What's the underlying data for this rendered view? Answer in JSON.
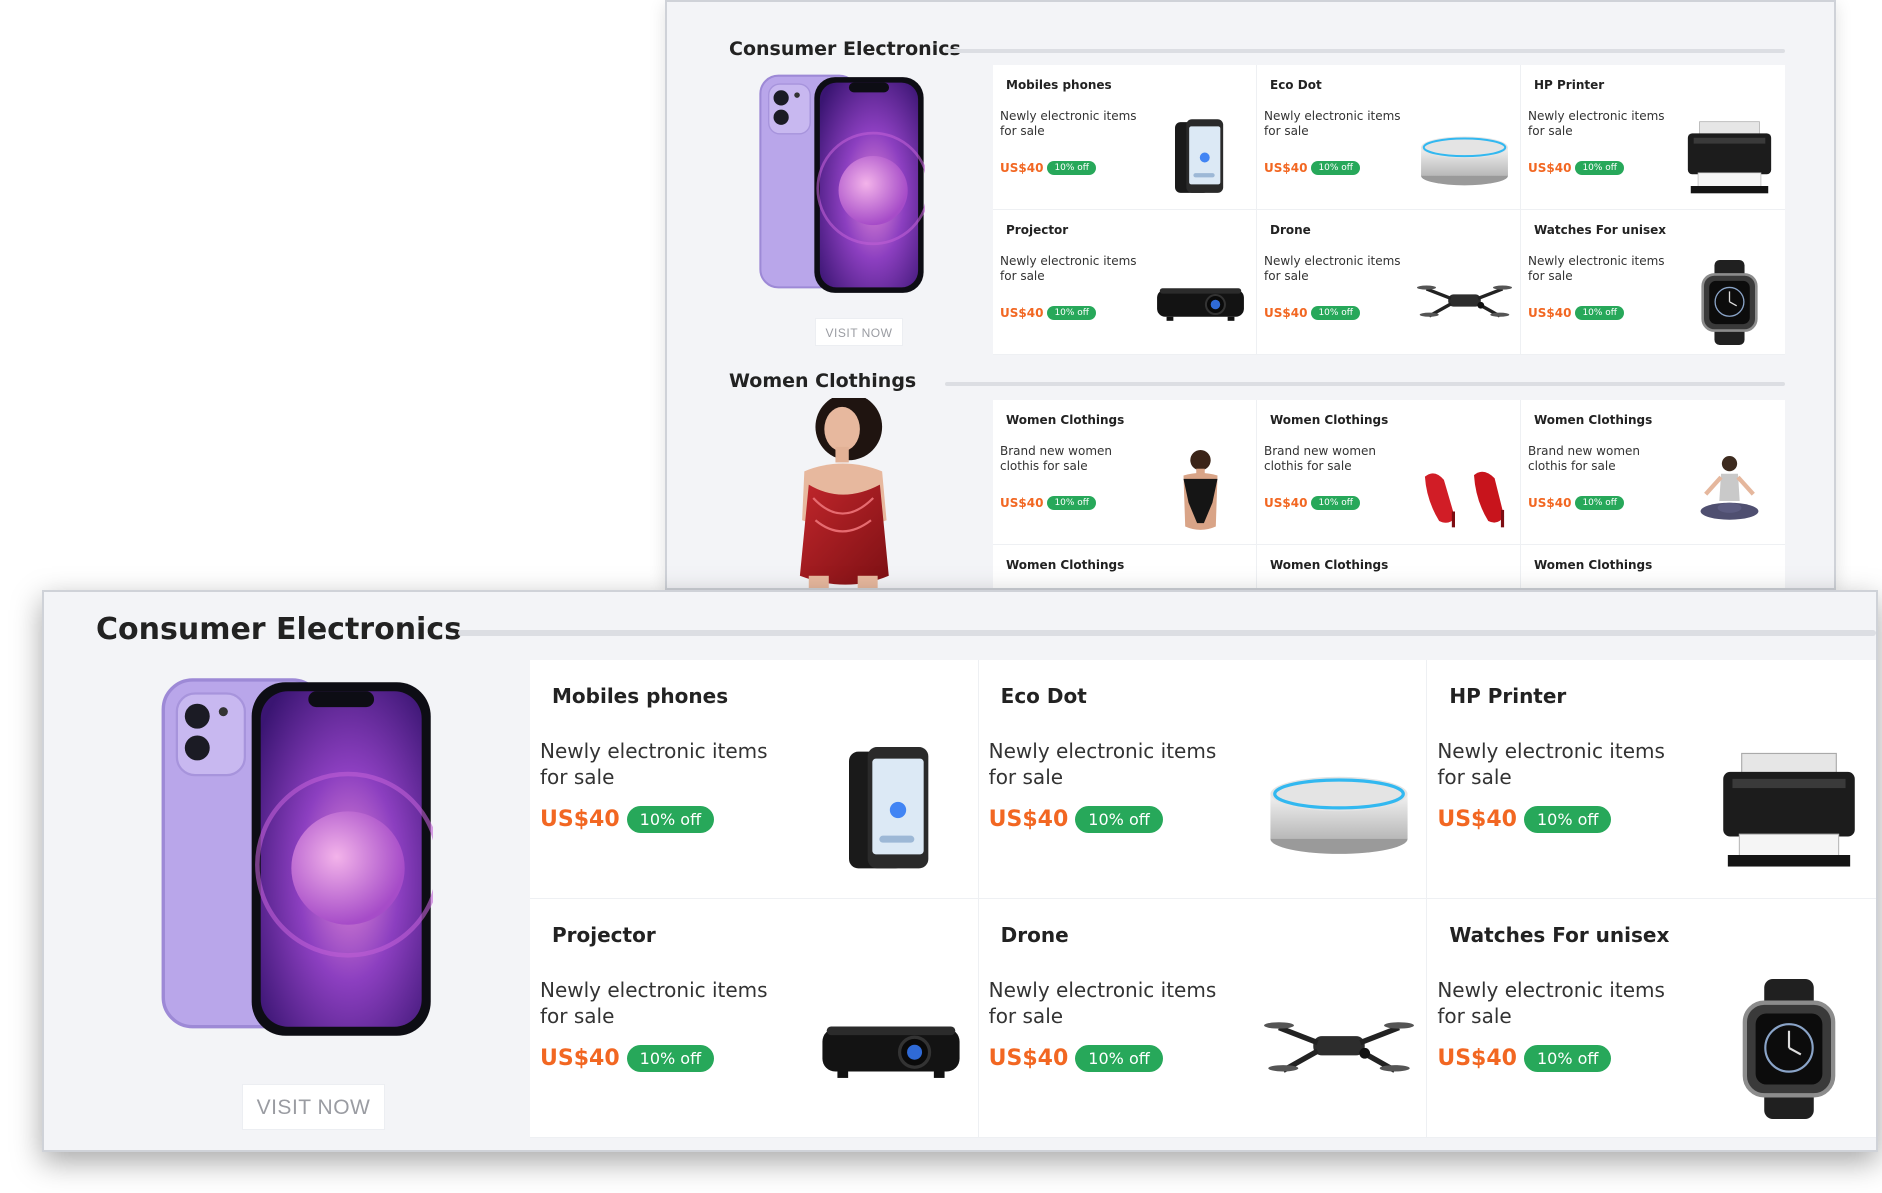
{
  "back_panel": {
    "electronics": {
      "title": "Consumer Electronics",
      "visit_label": "VISIT NOW",
      "hero_icon": "phone-image",
      "cards": [
        {
          "title": "Mobiles phones",
          "desc": "Newly electronic items for sale",
          "price": "US$40",
          "badge": "10% off",
          "icon": "smartphone-image"
        },
        {
          "title": "Eco Dot",
          "desc": "Newly electronic items for sale",
          "price": "US$40",
          "badge": "10% off",
          "icon": "smart-speaker-image"
        },
        {
          "title": "HP Printer",
          "desc": "Newly electronic items for sale",
          "price": "US$40",
          "badge": "10% off",
          "icon": "printer-image"
        },
        {
          "title": "Projector",
          "desc": "Newly electronic items for sale",
          "price": "US$40",
          "badge": "10% off",
          "icon": "projector-image"
        },
        {
          "title": "Drone",
          "desc": "Newly electronic items for sale",
          "price": "US$40",
          "badge": "10% off",
          "icon": "drone-image"
        },
        {
          "title": "Watches For unisex",
          "desc": "Newly electronic items for sale",
          "price": "US$40",
          "badge": "10% off",
          "icon": "smartwatch-image"
        }
      ]
    },
    "women": {
      "title": "Women Clothings",
      "hero_icon": "model-image",
      "cards": [
        {
          "title": "Women Clothings",
          "desc": "Brand new women clothis for sale",
          "price": "US$40",
          "badge": "10% off",
          "icon": "lingerie-image"
        },
        {
          "title": "Women Clothings",
          "desc": "Brand new women clothis for sale",
          "price": "US$40",
          "badge": "10% off",
          "icon": "red-heels-image"
        },
        {
          "title": "Women Clothings",
          "desc": "Brand new women clothis for sale",
          "price": "US$40",
          "badge": "10% off",
          "icon": "yoga-woman-image"
        },
        {
          "title": "Women Clothings"
        },
        {
          "title": "Women Clothings"
        },
        {
          "title": "Women Clothings"
        }
      ]
    }
  },
  "front_panel": {
    "title": "Consumer Electronics",
    "visit_label": "VISIT NOW",
    "hero_icon": "phone-image",
    "cards": [
      {
        "title": "Mobiles phones",
        "desc": "Newly electronic items for sale",
        "price": "US$40",
        "badge": "10% off",
        "icon": "smartphone-image"
      },
      {
        "title": "Eco Dot",
        "desc": "Newly electronic items for sale",
        "price": "US$40",
        "badge": "10% off",
        "icon": "smart-speaker-image"
      },
      {
        "title": "HP Printer",
        "desc": "Newly electronic items for sale",
        "price": "US$40",
        "badge": "10% off",
        "icon": "printer-image"
      },
      {
        "title": "Projector",
        "desc": "Newly electronic items for sale",
        "price": "US$40",
        "badge": "10% off",
        "icon": "projector-image"
      },
      {
        "title": "Drone",
        "desc": "Newly electronic items for sale",
        "price": "US$40",
        "badge": "10% off",
        "icon": "drone-image"
      },
      {
        "title": "Watches For unisex",
        "desc": "Newly electronic items for sale",
        "price": "US$40",
        "badge": "10% off",
        "icon": "smartwatch-image"
      }
    ]
  },
  "colors": {
    "price": "#f26722",
    "badge": "#27a85a",
    "panel_bg": "#f3f4f7",
    "phone_body": "#b9a6ea"
  }
}
